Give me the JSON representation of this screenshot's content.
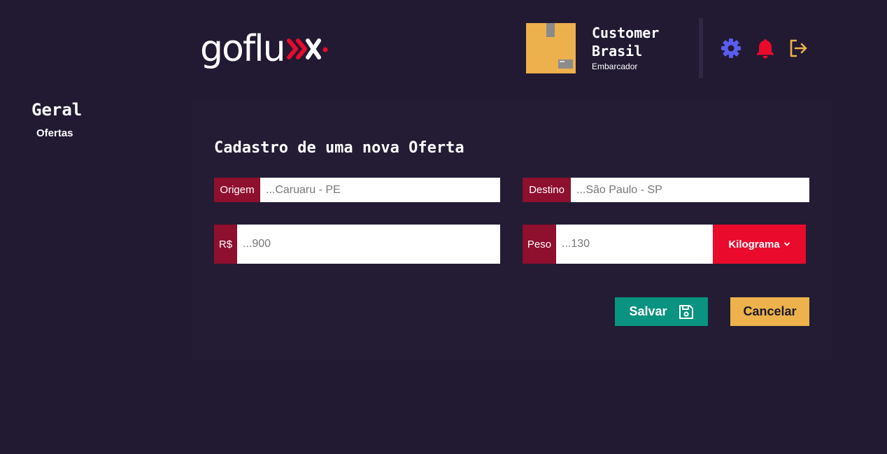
{
  "brand": {
    "logo_text": "goflu",
    "accent_color": "#ea0a2c"
  },
  "profile": {
    "name": "Customer Brasil",
    "role": "Embarcador",
    "avatar_icon": "package-box-icon"
  },
  "header_icons": [
    "gear-icon",
    "bell-icon",
    "logout-icon"
  ],
  "sidebar": {
    "title": "Geral",
    "items": [
      {
        "label": "Ofertas"
      }
    ]
  },
  "form": {
    "title": "Cadastro de uma nova Oferta",
    "origem": {
      "label": "Origem",
      "placeholder": "...Caruaru - PE",
      "value": ""
    },
    "destino": {
      "label": "Destino",
      "placeholder": "...São Paulo - SP",
      "value": ""
    },
    "preco": {
      "label": "R$",
      "placeholder": "...900",
      "value": ""
    },
    "peso": {
      "label": "Peso",
      "placeholder": "...130",
      "value": ""
    },
    "unit": {
      "selected": "Kilograma"
    },
    "save_label": "Salvar",
    "cancel_label": "Cancelar"
  },
  "colors": {
    "background": "#211a32",
    "prefix": "#8e0f2e",
    "save": "#0a9380",
    "cancel": "#edb24b",
    "gear": "#5b5cf0",
    "bell": "#ea0a2c",
    "logout": "#edb24b"
  }
}
